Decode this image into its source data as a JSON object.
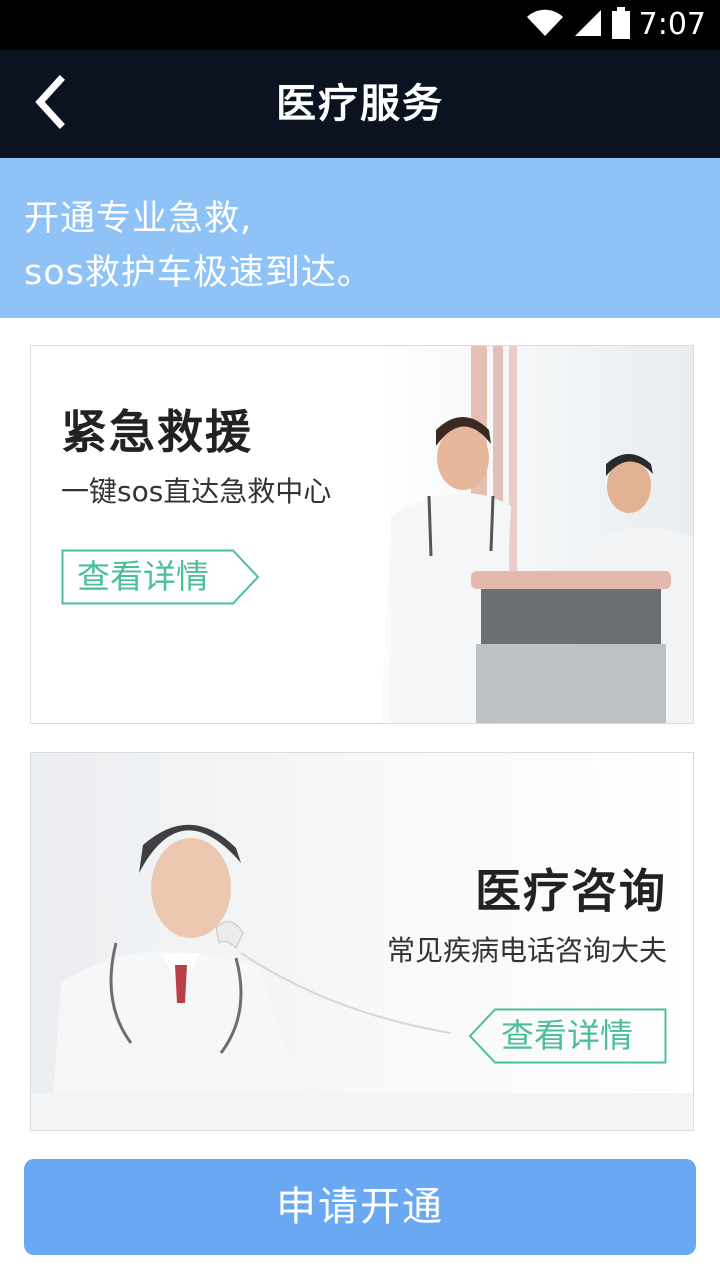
{
  "status_bar": {
    "time": "7:07",
    "icons": [
      "wifi-icon",
      "signal-icon",
      "battery-icon"
    ]
  },
  "nav": {
    "title": "医疗服务",
    "back_icon": "chevron-left-icon"
  },
  "banner": {
    "line1": "开通专业急救,",
    "line2": "sos救护车极速到达。"
  },
  "cards": [
    {
      "title": "紧急救援",
      "subtitle": "一键sos直达急救中心",
      "button_label": "查看详情",
      "image": "doctors-pushing-stretcher"
    },
    {
      "title": "医疗咨询",
      "subtitle": "常见疾病电话咨询大夫",
      "button_label": "查看详情",
      "image": "doctor-on-phone"
    }
  ],
  "apply_button": {
    "label": "申请开通"
  },
  "colors": {
    "status_bar": "#000000",
    "nav_bar": "#0b1320",
    "banner": "#8fc2f7",
    "detail_accent": "#4cbf9a",
    "apply_button": "#6aa8f3"
  }
}
